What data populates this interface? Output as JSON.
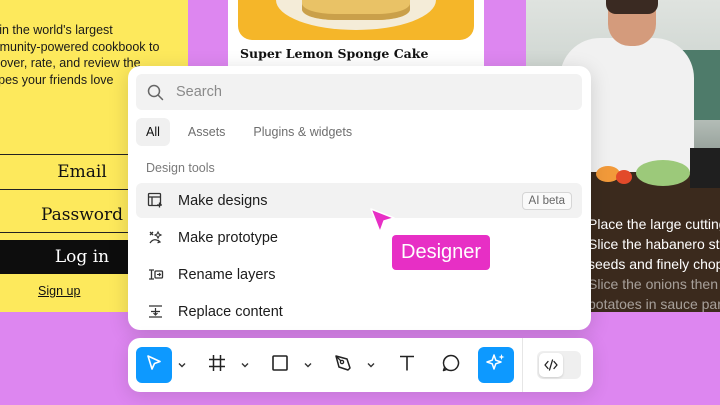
{
  "signup_frame": {
    "intro_lines": [
      "Join the world's largest",
      "community-powered cookbook to",
      "discover, rate, and review the",
      "recipes your friends love"
    ],
    "email_label": "Email",
    "password_label": "Password",
    "login_label": "Log in",
    "signup_label": "Sign up"
  },
  "recipe_frame": {
    "title": "Super Lemon Sponge Cake"
  },
  "video_frame": {
    "caption_lines": [
      "Place the large cutting board",
      "Slice the habanero stem",
      "seeds and finely chop",
      "Slice the onions then",
      "potatoes in sauce pan"
    ]
  },
  "palette": {
    "search_placeholder": "Search",
    "tabs": [
      {
        "label": "All",
        "active": true
      },
      {
        "label": "Assets",
        "active": false
      },
      {
        "label": "Plugins & widgets",
        "active": false
      }
    ],
    "section_title": "Design tools",
    "items": [
      {
        "label": "Make designs",
        "icon": "make-designs-icon",
        "badge": "AI beta",
        "highlighted": true
      },
      {
        "label": "Make prototype",
        "icon": "prototype-icon"
      },
      {
        "label": "Rename layers",
        "icon": "rename-icon"
      },
      {
        "label": "Replace content",
        "icon": "replace-content-icon"
      }
    ]
  },
  "cursor": {
    "label": "Designer",
    "color": "#e72fc5"
  },
  "toolbar": {
    "tools": [
      "move-tool",
      "frame-tool",
      "shape-tool",
      "pen-tool",
      "text-tool",
      "comment-tool",
      "ai-tool"
    ],
    "active_tool": "move-tool",
    "dev_mode": "off"
  },
  "colors": {
    "accent": "#0d99ff",
    "cursor_pink": "#e72fc5",
    "canvas_bg": "#dd86f0",
    "signup_bg": "#fde95c"
  }
}
